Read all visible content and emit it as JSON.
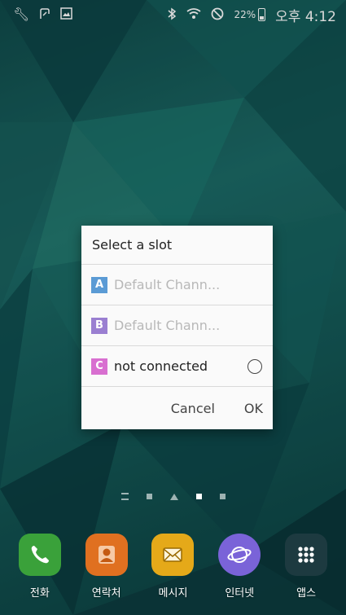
{
  "status_bar": {
    "left_icons": [
      "wrench-icon",
      "nfc-icon",
      "gallery-icon"
    ],
    "right_icons": [
      "bluetooth-icon",
      "wifi-icon",
      "do-not-disturb-icon"
    ],
    "battery_percent": "22%",
    "time": "오후 4:12"
  },
  "dialog": {
    "title": "Select a slot",
    "slots": [
      {
        "letter": "A",
        "label": "Default Chann...",
        "color": "#5b9bd5",
        "enabled": false
      },
      {
        "letter": "B",
        "label": "Default Chann...",
        "color": "#9a7fd1",
        "enabled": false
      },
      {
        "letter": "C",
        "label": "not connected",
        "color": "#d86fd0",
        "enabled": true,
        "selected": false
      }
    ],
    "cancel_label": "Cancel",
    "ok_label": "OK"
  },
  "page_indicator": {
    "pages": 5,
    "active_index": 3
  },
  "dock": [
    {
      "label": "전화",
      "icon": "phone-icon",
      "color": "#3aa13a"
    },
    {
      "label": "연락처",
      "icon": "contacts-icon",
      "color": "#e07020"
    },
    {
      "label": "메시지",
      "icon": "messages-icon",
      "color": "#e5a919"
    },
    {
      "label": "인터넷",
      "icon": "internet-icon",
      "color": "#7a63d8"
    },
    {
      "label": "앱스",
      "icon": "apps-icon",
      "color": "#1d3a40"
    }
  ]
}
